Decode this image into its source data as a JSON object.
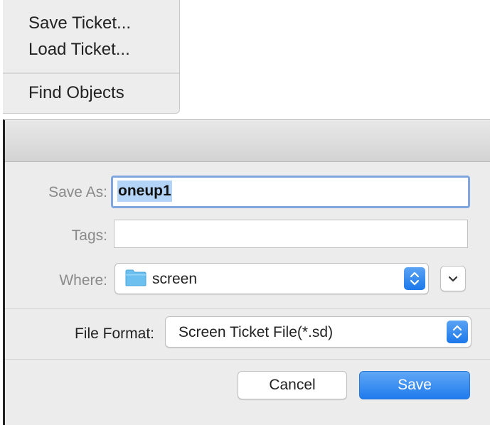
{
  "menu": {
    "items": [
      {
        "label": "Save Ticket..."
      },
      {
        "label": "Load Ticket..."
      },
      {
        "label": "Find Objects"
      }
    ]
  },
  "dialog": {
    "save_as": {
      "label": "Save As:",
      "value": "oneup1"
    },
    "tags": {
      "label": "Tags:",
      "value": "",
      "placeholder": ""
    },
    "where": {
      "label": "Where:",
      "value": "screen",
      "icon": "folder-icon"
    },
    "file_format": {
      "label": "File Format:",
      "value": "Screen Ticket File(*.sd)"
    },
    "buttons": {
      "cancel": "Cancel",
      "save": "Save"
    },
    "colors": {
      "accent": "#1f7bed",
      "selection": "#b4d4f7",
      "folder": "#6cc0f0"
    }
  }
}
